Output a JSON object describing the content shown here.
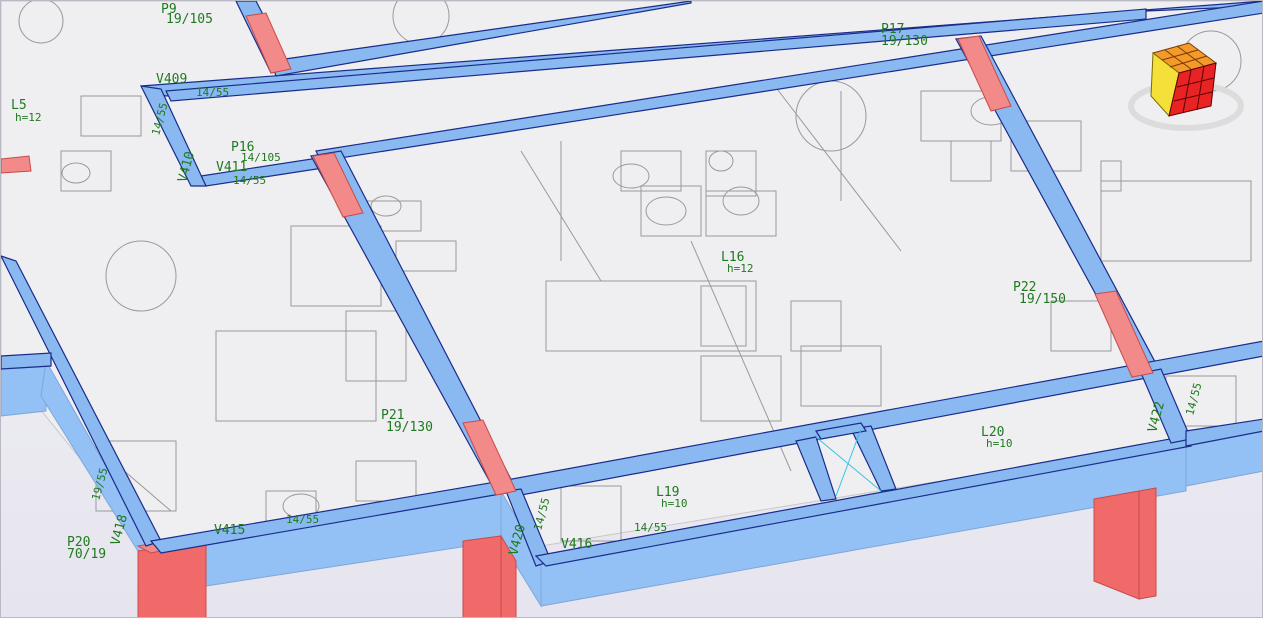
{
  "viewer": {
    "nav_cube": "view-cube-icon",
    "colors": {
      "beam": "#8ab8f0",
      "column": "#f06a6a",
      "label": "#1f7a1f",
      "slab": "#efeff1"
    }
  },
  "labels": {
    "p9": "P9",
    "p9_size": "19/105",
    "l5": "L5",
    "l5_h": "h=12",
    "v409": "V409",
    "v409_size": "14/55",
    "p16": "P16",
    "p16_size": "14/105",
    "v411": "V411",
    "v411_size": "14/55",
    "v410": "V410",
    "v410_size": "14/55",
    "p17": "P17",
    "p17_size": "19/130",
    "l16": "L16",
    "l16_h": "h=12",
    "p22": "P22",
    "p22_size": "19/150",
    "p21": "P21",
    "p21_size": "19/130",
    "l19": "L19",
    "l19_h": "h=10",
    "l20": "L20",
    "l20_h": "h=10",
    "v415": "V415",
    "v415_size": "14/55",
    "v418": "V418",
    "v418_size": "19/55",
    "p20": "P20",
    "p20_size": "70/19",
    "v420": "V420",
    "v420_size": "14/55",
    "v416": "V416",
    "v416_size": "14/55",
    "v422": "V422",
    "v422_size": "14/55"
  }
}
